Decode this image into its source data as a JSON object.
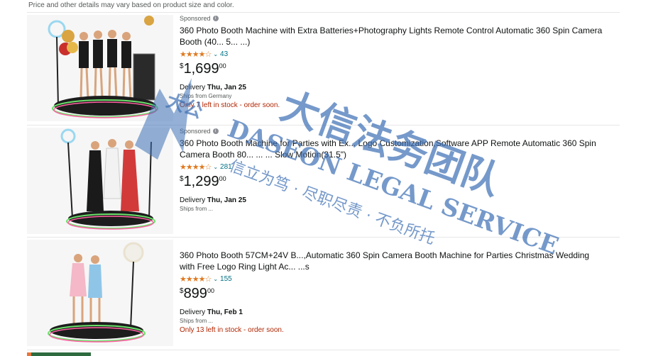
{
  "top_note": "Price and other details may vary based on product size and color.",
  "results": [
    {
      "sponsored": "Sponsored",
      "title": "360 Photo Booth Machine with Extra Batteries+Photography Lights Remote Control Automatic 360 Spin Camera Booth (40... 5... ...)",
      "stars": "★★★★☆",
      "rating_value": 4.3,
      "chevron": "⌄",
      "review_count": "43",
      "price_currency": "$",
      "price_whole": "1,699",
      "price_fraction": "00",
      "delivery_label": "Delivery",
      "delivery_date": "Thu, Jan 25",
      "ships_from": "Ships from Germany",
      "stock_note": "Only 7 left in stock - order soon.",
      "image_alt": "360 spin photo booth with four women on platform, balloons and flight case"
    },
    {
      "sponsored": "Sponsored",
      "title": "360 Photo Booth Machine for Parties with Ex... Logo Customization,Software APP Remote Automatic 360 Spin Camera Booth 80... ... ... Slow Motion(31.5\")",
      "stars": "★★★★☆",
      "rating_value": 4.5,
      "chevron": "⌄",
      "review_count": "281",
      "price_currency": "$",
      "price_whole": "1,299",
      "price_fraction": "00",
      "delivery_label": "Delivery",
      "delivery_date": "Thu, Jan 25",
      "ships_from": "Ships from ...",
      "stock_note": "",
      "image_alt": "360 spin photo booth with three women in evening dresses"
    },
    {
      "sponsored": "",
      "title": "360 Photo Booth 57CM+24V B...,Automatic 360 Spin Camera Booth Machine for Parties Christmas Wedding with Free Logo Ring Light Ac... ...s",
      "stars": "★★★★☆",
      "rating_value": 4.5,
      "chevron": "⌄",
      "review_count": "155",
      "price_currency": "$",
      "price_whole": "899",
      "price_fraction": "00",
      "delivery_label": "Delivery",
      "delivery_date": "Thu, Feb 1",
      "ships_from": "Ships from ...",
      "stock_note": "Only 13 left in stock - order soon.",
      "image_alt": "360 spin photo booth with two women and ring light"
    }
  ],
  "watermark": {
    "line1": "大信法务团队",
    "line2": "DASEON LEGAL SERVICE",
    "line3": "信立为笃 · 尽职尽责 · 不负所托",
    "side": "大公",
    "color": "#3c6fb4"
  },
  "colors": {
    "link": "#007185",
    "star": "#de7921",
    "stock": "#b12704",
    "muted": "#565959"
  }
}
